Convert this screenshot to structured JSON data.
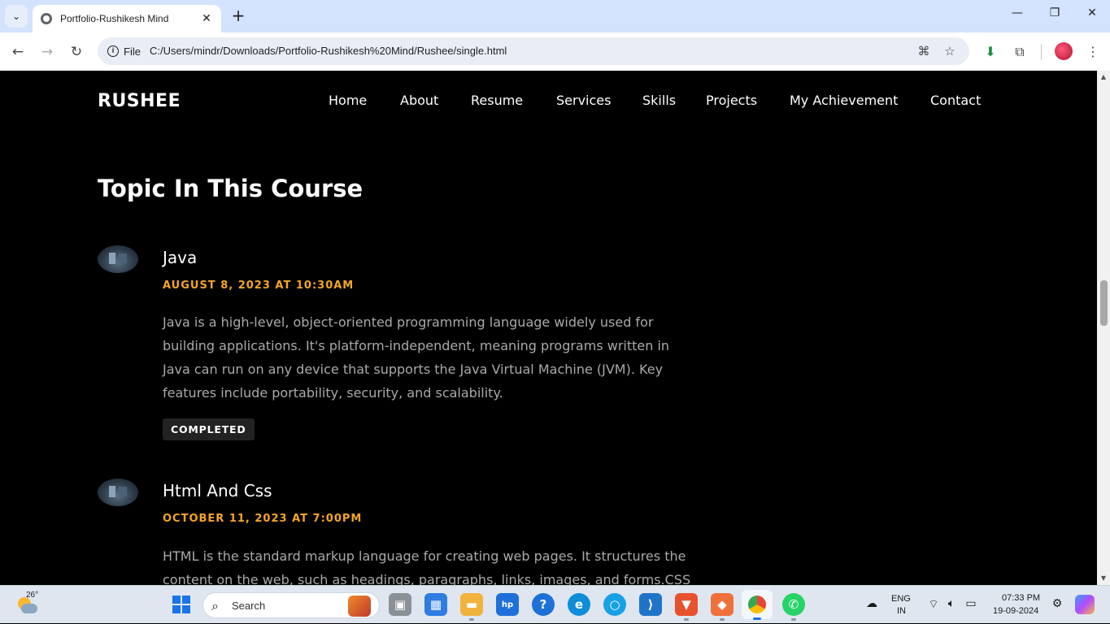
{
  "browser": {
    "tab_title": "Portfolio-Rushikesh Mind",
    "close_tab": "✕",
    "new_tab": "+",
    "chip_label": "File",
    "url": "C:/Users/mindr/Downloads/Portfolio-Rushikesh%20Mind/Rushee/single.html"
  },
  "site": {
    "brand": "RUSHEE",
    "nav": [
      "Home",
      "About",
      "Resume",
      "Services",
      "Skills",
      "Projects",
      "My Achievement",
      "Contact"
    ]
  },
  "section": {
    "title": "Topic In This Course",
    "items": [
      {
        "title": "Java",
        "date": "AUGUST 8, 2023 AT 10:30AM",
        "description": "Java is a high-level, object-oriented programming language widely used for building applications. It's platform-independent, meaning programs written in Java can run on any device that supports the Java Virtual Machine (JVM). Key features include portability, security, and scalability.",
        "badge": "COMPLETED"
      },
      {
        "title": "Html And Css",
        "date": "OCTOBER 11, 2023 AT 7:00PM",
        "description": "HTML is the standard markup language for creating web pages. It structures the content on the web, such as headings, paragraphs, links, images, and forms.CSS"
      }
    ]
  },
  "taskbar": {
    "temperature": "26°",
    "search_placeholder": "Search",
    "language": "ENG",
    "region": "IN",
    "time": "07:33 PM",
    "date": "19-09-2024"
  }
}
